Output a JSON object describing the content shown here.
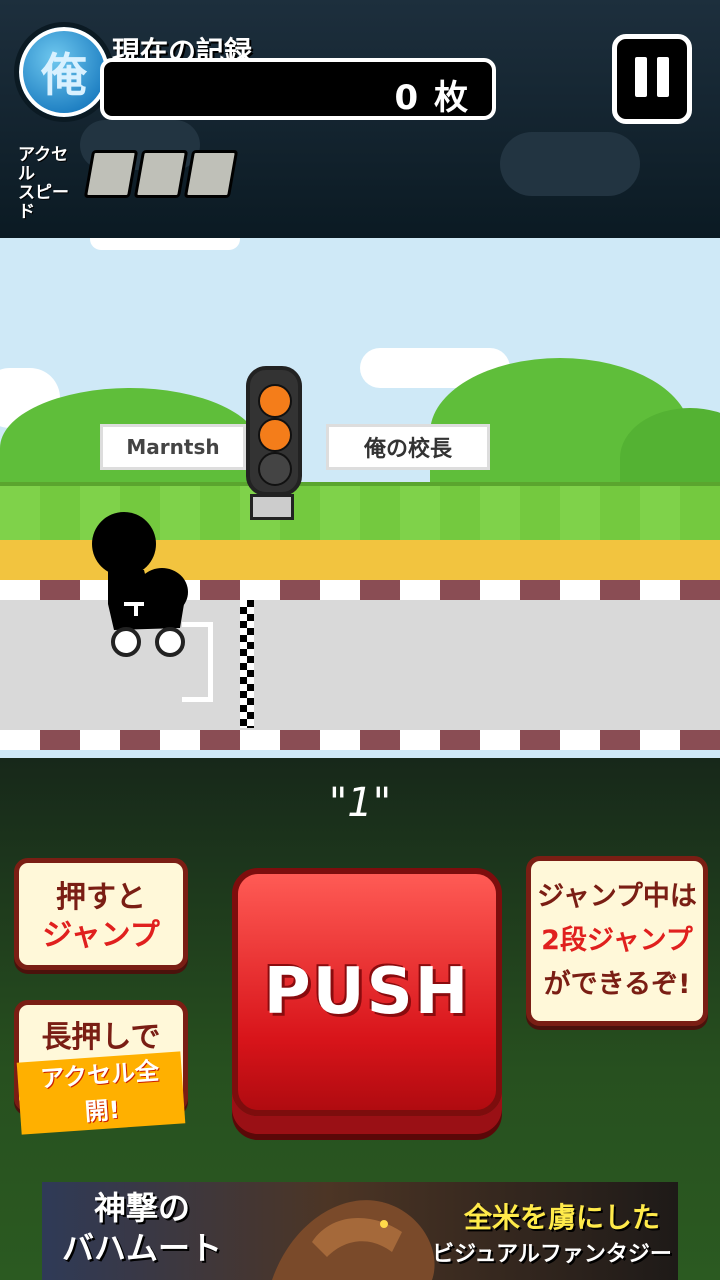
{
  "header": {
    "badge_char": "俺",
    "record_title": "現在の記録",
    "record_value": "0 枚",
    "accel_label_line1": "アクセル",
    "accel_label_line2": "スピード",
    "accel_flags": 3
  },
  "scene": {
    "billboard_left": "Marntsh",
    "billboard_right": "俺の校長",
    "traffic_light": [
      "orange",
      "orange",
      "off"
    ]
  },
  "counter": "\"1\"",
  "controls": {
    "push_label": "PUSH",
    "tip_jump_line1": "押すと",
    "tip_jump_line2": "ジャンプ",
    "tip_accel_line1": "長押しで",
    "tip_accel_line2": "アクセル全開!",
    "tip_double_line1": "ジャンプ中は",
    "tip_double_line2": "2段ジャンプ",
    "tip_double_line3": "ができるぞ!"
  },
  "ad": {
    "left_line1": "神撃の",
    "left_line2": "バハムート",
    "right_line1": "全米を虜にした",
    "right_line2": "ビジュアルファンタジー"
  },
  "colors": {
    "accent_red": "#d8141a",
    "bubble_border": "#7a1e14",
    "highlight_red": "#e0201e"
  }
}
